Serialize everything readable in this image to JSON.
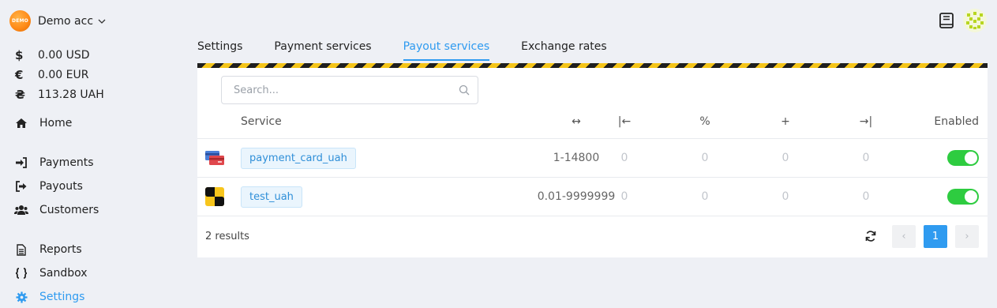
{
  "account": {
    "name": "Demo acc",
    "logo_text": "DEMO"
  },
  "balances": [
    {
      "symbol": "$",
      "value": "0.00 USD"
    },
    {
      "symbol": "€",
      "value": "0.00 EUR"
    },
    {
      "symbol": "₴",
      "value": "113.28 UAH"
    }
  ],
  "nav": {
    "home": "Home",
    "payments": "Payments",
    "payouts": "Payouts",
    "customers": "Customers",
    "reports": "Reports",
    "sandbox": "Sandbox",
    "settings": "Settings"
  },
  "tabs": [
    {
      "label": "Settings"
    },
    {
      "label": "Payment services"
    },
    {
      "label": "Payout services",
      "active": true
    },
    {
      "label": "Exchange rates"
    }
  ],
  "search": {
    "placeholder": "Search..."
  },
  "table": {
    "headers": {
      "service": "Service",
      "range": "↔",
      "c3": "|←",
      "c4": "%",
      "c5": "+",
      "c6": "→|",
      "enabled": "Enabled"
    },
    "rows": [
      {
        "service": "payment_card_uah",
        "range": "1-14800",
        "c3": "0",
        "c4": "0",
        "c5": "0",
        "c6": "0",
        "enabled": true
      },
      {
        "service": "test_uah",
        "range": "0.01-9999999",
        "c3": "0",
        "c4": "0",
        "c5": "0",
        "c6": "0",
        "enabled": true
      }
    ]
  },
  "footer": {
    "results": "2 results",
    "page": "1",
    "prev": "‹",
    "next": "›"
  },
  "colors": {
    "accent": "#2f9bf0",
    "toggle_on": "#2ecc40",
    "stripe_yellow": "#f5c518",
    "stripe_dark": "#1f1f1f"
  }
}
